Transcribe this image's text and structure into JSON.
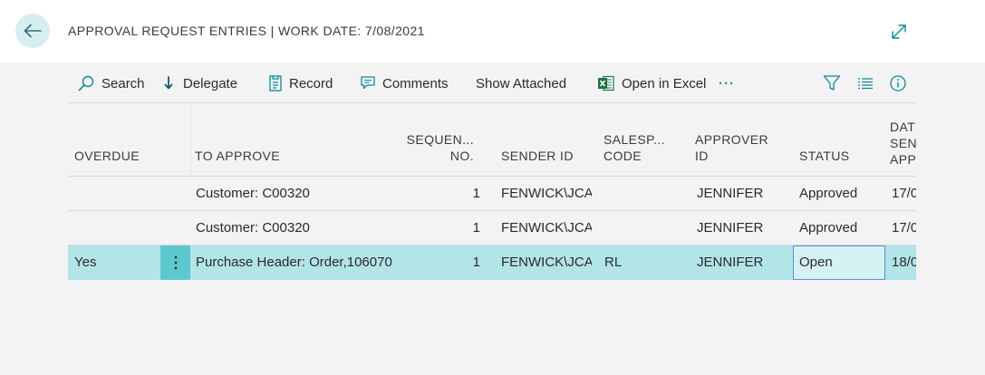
{
  "header": {
    "title": "APPROVAL REQUEST ENTRIES | WORK DATE: 7/08/2021",
    "back_icon": "arrow-left-icon",
    "expand_icon": "expand-diagonal-icon"
  },
  "actions": [
    {
      "label": "Search",
      "icon": "search-icon"
    },
    {
      "label": "Delegate",
      "icon": "arrow-down-icon"
    },
    {
      "label": "Record",
      "icon": "record-icon"
    },
    {
      "label": "Comments",
      "icon": "comment-icon"
    },
    {
      "label": "Show Attached"
    },
    {
      "label": "Open in Excel",
      "icon": "excel-icon"
    },
    {
      "label": "···",
      "icon": "more-icon"
    }
  ],
  "tools": [
    "filter-icon",
    "list-view-icon",
    "info-icon"
  ],
  "columns": {
    "overdue": [
      "OVERDUE"
    ],
    "to_approve": [
      "TO APPROVE"
    ],
    "sequence": [
      "SEQUEN...",
      "NO."
    ],
    "sender_id": [
      "SENDER ID"
    ],
    "salesperson": [
      "SALESP...",
      "CODE"
    ],
    "approver": [
      "APPROVER",
      "ID"
    ],
    "status": [
      "STATUS"
    ],
    "date_sent": [
      "DAT",
      "SEN",
      "APP"
    ]
  },
  "rows": [
    {
      "overdue": "",
      "to_approve": "Customer: C00320",
      "sequence": "1",
      "sender_id": "FENWICK\\JCA",
      "salesperson": "",
      "approver": "JENNIFER",
      "status": "Approved",
      "date_sent": "17/0"
    },
    {
      "overdue": "",
      "to_approve": "Customer: C00320",
      "sequence": "1",
      "sender_id": "FENWICK\\JCA",
      "salesperson": "",
      "approver": "JENNIFER",
      "status": "Approved",
      "date_sent": "17/0"
    },
    {
      "overdue": "Yes",
      "to_approve": "Purchase Header: Order,106070",
      "sequence": "1",
      "sender_id": "FENWICK\\JCA",
      "salesperson": "RL",
      "approver": "JENNIFER",
      "status": "Open",
      "date_sent": "18/0"
    }
  ],
  "row_menu_icon": "vertical-dots-icon",
  "colors": {
    "accent": "#0b8a94",
    "selected_row": "#b2e4e8",
    "excel_green": "#1d7044"
  }
}
